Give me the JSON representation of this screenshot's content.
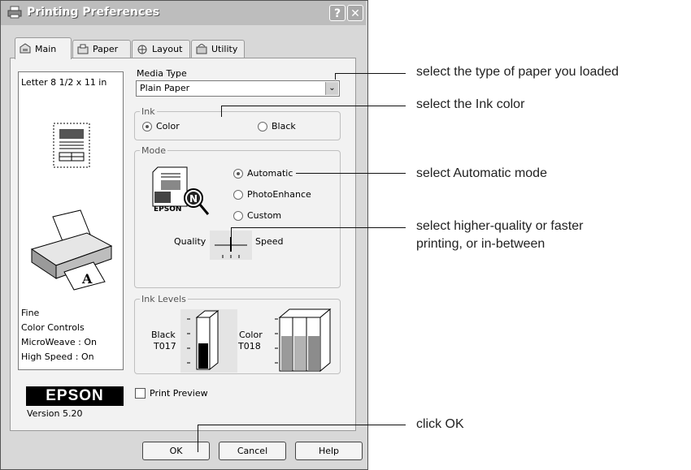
{
  "window": {
    "title": "Printing Preferences",
    "help_button": "?",
    "close_button": "✕"
  },
  "tabs": [
    {
      "label": "Main"
    },
    {
      "label": "Paper"
    },
    {
      "label": "Layout"
    },
    {
      "label": "Utility"
    }
  ],
  "preview": {
    "paper_size": "Letter 8 1/2 x 11 in",
    "status_lines": [
      "Fine",
      "Color Controls",
      "MicroWeave : On",
      "High Speed : On"
    ]
  },
  "brand": {
    "logo": "EPSON",
    "version": "Version 5.20",
    "illustration_text": "EPSON"
  },
  "media_type": {
    "label": "Media Type",
    "value": "Plain Paper"
  },
  "ink": {
    "legend": "Ink",
    "options": [
      {
        "label": "Color",
        "selected": true
      },
      {
        "label": "Black",
        "selected": false
      }
    ]
  },
  "mode": {
    "legend": "Mode",
    "options": [
      {
        "label": "Automatic",
        "selected": true
      },
      {
        "label": "PhotoEnhance",
        "selected": false
      },
      {
        "label": "Custom",
        "selected": false
      }
    ],
    "slider_left": "Quality",
    "slider_right": "Speed"
  },
  "ink_levels": {
    "legend": "Ink Levels",
    "black": {
      "name": "Black",
      "code": "T017",
      "level": 0.5,
      "color": "#000000"
    },
    "color": {
      "name": "Color",
      "code": "T018",
      "level": 0.66,
      "colors": [
        "#9a9a9a",
        "#b3b3b3",
        "#8c8c8c"
      ]
    }
  },
  "print_preview": {
    "label": "Print Preview",
    "checked": false
  },
  "buttons": {
    "ok": "OK",
    "cancel": "Cancel",
    "help": "Help"
  },
  "callouts": {
    "media": "select the type of paper you loaded",
    "ink": "select the Ink color",
    "mode": "select Automatic mode",
    "slider_line1": "select higher-quality or faster",
    "slider_line2": "printing, or in-between",
    "ok": "click OK"
  }
}
